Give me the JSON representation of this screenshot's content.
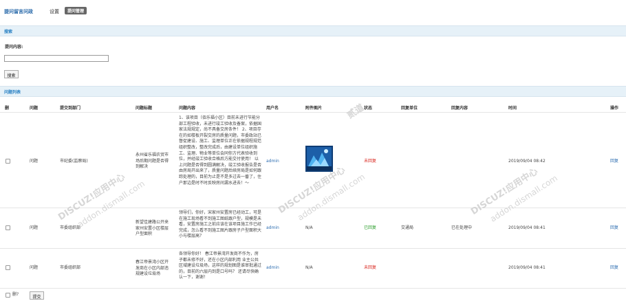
{
  "header": {
    "app_title": "提问留言问政",
    "nav_settings": "设置",
    "nav_active": "提问管理"
  },
  "search": {
    "section_title": "搜索",
    "field_label": "提问内容:",
    "field_value": "",
    "submit_label": "搜索"
  },
  "list": {
    "section_title": "问题列表",
    "columns": [
      "删",
      "问题",
      "提交到部门",
      "问题标题",
      "问题内容",
      "用户名",
      "附件图片",
      "状态",
      "回复单位",
      "回复内容",
      "时间",
      "操作"
    ],
    "rows": [
      {
        "type": "问题",
        "dept": "市纪委(监察局)",
        "title": "永州省乐福农贸市场后期问题是否得到解决",
        "content": "1、该项目（佰乐福小区）目前未进行节能分部工程验收，未进行竣工验收及备案，依据国家法规规定，尚不具备交房条件！ 2、项目存在的如楼板开裂交房的质量问题，市委政站已督促建设、施工、监理单位正在依据规程规范组织整改，整改完成后，由建设单位组织施工、监理、物业等单位会同你方代表验收到位，并经竣工验收合格后方能交付使用！ 以上问题是否得到圆满解决，竣工验收报告是否由房局开出来了，质量问题后续房局是如何跟踪处理的，目前为止是不是多过去一番了，住户那边是时不时反映房间漏水进去！～",
        "user": "admin",
        "attachment": "",
        "status": "未回复",
        "reply_unit": "",
        "reply_content": "",
        "time": "2019/09/04 08:42",
        "action": "回复"
      },
      {
        "type": "问题",
        "dept": "市委组织部",
        "title": "新望佳建路公开来家州安置小区楼层户型面积",
        "content": "领导们，你好，宋家州安置房已经动工，可是在施工现场看不到施工图纸跟户型，规模是未看，安置房施工之前应该在该项目施工作已经完成，怎么看不到施工图片跟房子户型面积大小与楼层高？",
        "user": "admin",
        "attachment": "N/A",
        "status": "已回复",
        "reply_unit": "交通局",
        "reply_content": "已在处理中",
        "time": "2019/09/04 08:41",
        "action": "回复"
      },
      {
        "type": "问题",
        "dept": "市委组织部",
        "title": "春江帝景湾小区开发商在小区内部违规建设垃圾场",
        "content": "各领导你好！ 春江帝景湾开发商不作为，房子都未修不好，还在小区内部利用 业主公共区域建设垃圾场，这样的规划图是谁审批通过的，目前的六层内到是口号吗？ 还请尽快确认一下，谢谢！",
        "user": "admin",
        "attachment": "N/A",
        "status": "未回复",
        "reply_unit": "",
        "reply_content": "",
        "time": "2019/09/04 08:41",
        "action": "回复"
      }
    ]
  },
  "footer": {
    "delete_label": "删?",
    "submit_label": "提交"
  },
  "watermark": {
    "brand": "DISCUZ!应用中心",
    "url": "addon.dismall.com",
    "mark": "贰道"
  },
  "colors": {
    "link": "#2b6cb0",
    "status_unreplied": "#d9251d",
    "status_replied": "#2a9d2a",
    "section_bar": "#e6f1f8",
    "title": "#2366a8"
  }
}
